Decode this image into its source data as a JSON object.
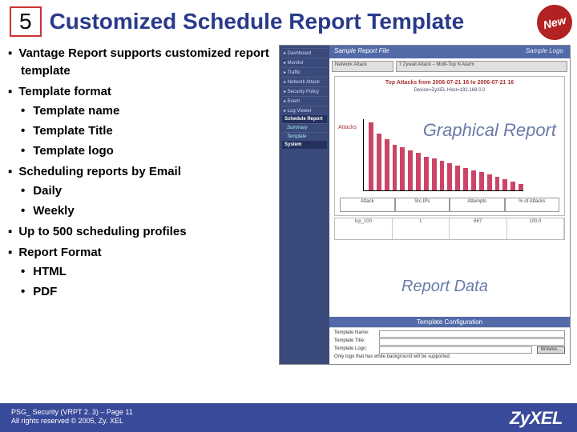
{
  "header": {
    "number": "5",
    "title": "Customized Schedule Report Template",
    "badge": "New"
  },
  "bullets": [
    {
      "text": "Vantage Report supports customized report template"
    },
    {
      "text": "Template format",
      "sub": [
        "Template name",
        "Template Title",
        "Template logo"
      ]
    },
    {
      "text": "Scheduling reports by Email",
      "sub": [
        "Daily",
        "Weekly"
      ]
    },
    {
      "text": "Up to 500 scheduling profiles"
    },
    {
      "text": "Report Format",
      "sub": [
        "HTML",
        "PDF"
      ]
    }
  ],
  "screenshot": {
    "nav": {
      "items": [
        "Dashboard",
        "Monitor",
        "Traffic",
        "Network Attack",
        "Security Policy",
        "Event",
        "Log Viewer"
      ],
      "schedule_header": "Schedule Report",
      "schedule_items": [
        "Summary",
        "Template"
      ],
      "system_header": "System"
    },
    "titlebar": "Sample Report File",
    "logo_text": "Sample Logo",
    "report_row": [
      "Network Attack",
      "7 Zywall Attack – Multi-Top N Alarm"
    ],
    "chart": {
      "title": "Top Attacks from 2006-07-21 16 to 2006-07-21 16",
      "subtitle": "Device=ZyXEL\nHost=192.168.0.0",
      "ylabel": "Attacks",
      "overlay_top": "Graphical\nReport",
      "overlay_bottom": "Report Data",
      "legend_cols": [
        "Attack",
        "Src.IPs",
        "Attempts",
        "% of Attacks"
      ],
      "table_row": [
        "tcp_100",
        "1",
        "667",
        "100.0"
      ]
    },
    "config": {
      "header": "Template Configuration",
      "rows": [
        "Template Name:",
        "Template Title:",
        "Template Logo:"
      ],
      "browse": "Browse...",
      "note": "Only logo that has white background will be supported."
    }
  },
  "footer": {
    "line1": "PSG_ Security (VRPT 2. 3) – Page 11",
    "line2": "All rights reserved © 2005, Zy. XEL",
    "brand": "ZyXEL"
  },
  "chart_data": {
    "type": "bar",
    "title": "Top Attacks from 2006-07-21 16 to 2006-07-21 16",
    "ylabel": "Attacks",
    "values": [
      60,
      50,
      45,
      40,
      38,
      35,
      33,
      30,
      28,
      26,
      24,
      22,
      20,
      18,
      16,
      14,
      12,
      10,
      8,
      6
    ]
  }
}
